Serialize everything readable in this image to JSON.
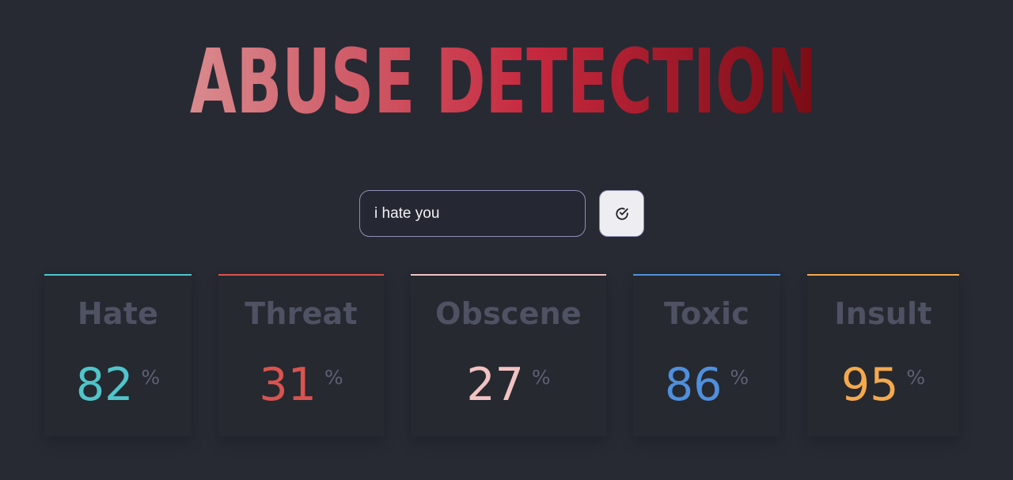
{
  "logo_text": "ABUSE DETECTION",
  "search": {
    "value": "i hate you"
  },
  "icons": {
    "submit": "check-circle-icon"
  },
  "colors": {
    "background": "#272a33",
    "logo_start": "#d98a8e",
    "logo_mid": "#c6283e",
    "logo_end": "#7a0c15"
  },
  "cards": [
    {
      "label": "Hate",
      "value": "82",
      "unit": "%",
      "color": "#4fc5cb"
    },
    {
      "label": "Threat",
      "value": "31",
      "unit": "%",
      "color": "#d9534f"
    },
    {
      "label": "Obscene",
      "value": "27",
      "unit": "%",
      "color": "#f1c3c3"
    },
    {
      "label": "Toxic",
      "value": "86",
      "unit": "%",
      "color": "#4f8fdc"
    },
    {
      "label": "Insult",
      "value": "95",
      "unit": "%",
      "color": "#f4a94e"
    }
  ]
}
